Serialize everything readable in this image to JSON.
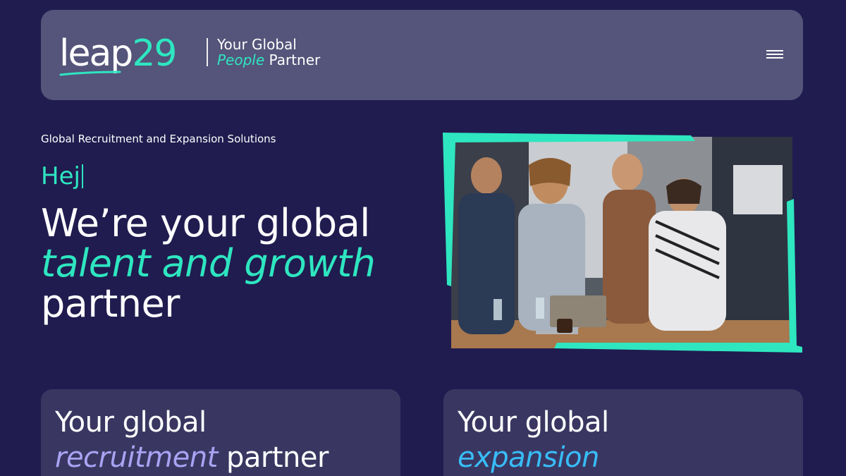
{
  "header": {
    "logo_word": "leap",
    "logo_number": "29",
    "tagline_line1": "Your Global",
    "tagline_accent": "People",
    "tagline_rest": "Partner",
    "menu_icon": "hamburger-menu-icon"
  },
  "hero": {
    "eyebrow": "Global Recruitment and Expansion Solutions",
    "greeting": "Hej",
    "title_line1": "We’re your global",
    "title_accent": "talent and growth",
    "title_line3": "partner"
  },
  "photo": {
    "description_icon": "team-meeting-photo"
  },
  "cards": [
    {
      "line1": "Your global",
      "accent": "recruitment",
      "rest": "partner"
    },
    {
      "line1": "Your global",
      "accent": "expansion",
      "rest": ""
    }
  ],
  "colors": {
    "background": "#201c4f",
    "header": "#55547a",
    "accent_green": "#2ee6c0",
    "card": "#393761",
    "accent_purple": "#a9a3f3",
    "accent_blue": "#38bdf8"
  }
}
